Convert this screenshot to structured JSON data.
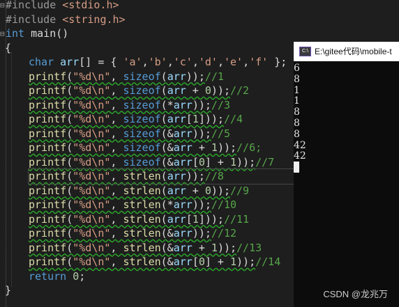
{
  "editor": {
    "lines": [
      "#include <stdio.h>",
      "#include <string.h>",
      "int main()",
      "{",
      "char arr[] = { 'a','b','c','d','e','f' };",
      "printf(\"%d\\n\", sizeof(arr));//1",
      "printf(\"%d\\n\", sizeof(arr + 0));//2",
      "printf(\"%d\\n\", sizeof(*arr));//3",
      "printf(\"%d\\n\", sizeof(arr[1]));//4",
      "printf(\"%d\\n\", sizeof(&arr));//5",
      "printf(\"%d\\n\", sizeof(&arr + 1));//6;",
      "printf(\"%d\\n\", sizeof(&arr[0] + 1));//7",
      "printf(\"%d\\n\", strlen(arr));//8",
      "printf(\"%d\\n\", strlen(arr + 0));//9",
      "printf(\"%d\\n\", strlen(*arr));//10",
      "printf(\"%d\\n\", strlen(arr[1]));//11",
      "printf(\"%d\\n\", strlen(&arr));//12",
      "printf(\"%d\\n\", strlen(&arr + 1));//13",
      "printf(\"%d\\n\", strlen(&arr[0] + 1));//14",
      "return 0;",
      "}"
    ],
    "current_line_index": 12
  },
  "console": {
    "title": "E:\\gitee代码\\mobile-t",
    "icon": "console-app-icon",
    "output": [
      "6",
      "8",
      "1",
      "1",
      "8",
      "8",
      "8",
      "42",
      "42"
    ]
  },
  "watermark": "CSDN @龙兆万",
  "colors": {
    "background": "#1e1e1e",
    "keyword": "#569cd6",
    "string": "#d69d85",
    "function": "#dcdcaa",
    "comment": "#57a64a",
    "number": "#b5cea8"
  }
}
